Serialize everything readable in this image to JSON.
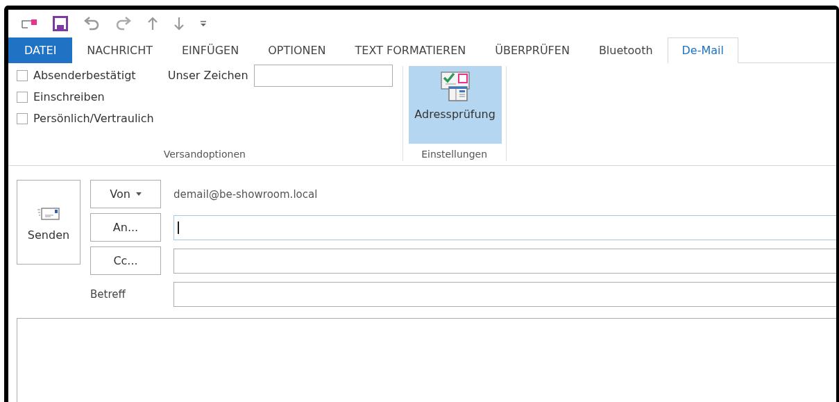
{
  "tabs": [
    {
      "label": "DATEI",
      "kind": "file",
      "selected": false
    },
    {
      "label": "NACHRICHT",
      "kind": "tab",
      "selected": false
    },
    {
      "label": "EINFÜGEN",
      "kind": "tab",
      "selected": false
    },
    {
      "label": "OPTIONEN",
      "kind": "tab",
      "selected": false
    },
    {
      "label": "TEXT FORMATIEREN",
      "kind": "tab",
      "selected": false
    },
    {
      "label": "ÜBERPRÜFEN",
      "kind": "tab",
      "selected": false
    },
    {
      "label": "Bluetooth",
      "kind": "tab",
      "selected": false
    },
    {
      "label": "De-Mail",
      "kind": "tab",
      "selected": true
    }
  ],
  "ribbon": {
    "groups": [
      {
        "label": "Versandoptionen",
        "checkboxes": [
          {
            "label": "Absenderbestätigt",
            "checked": false
          },
          {
            "label": "Einschreiben",
            "checked": false
          },
          {
            "label": "Persönlich/Vertraulich",
            "checked": false
          }
        ],
        "field": {
          "label": "Unser Zeichen"
        }
      },
      {
        "label": "Einstellungen",
        "button": {
          "label": "Adressprüfung",
          "on": true
        }
      }
    ]
  },
  "compose": {
    "send": {
      "label": "Senden"
    },
    "rows": [
      {
        "kind": "from",
        "button": "Von",
        "value": "demail@be-showroom.local"
      },
      {
        "kind": "field",
        "button": "An...",
        "focused": true
      },
      {
        "kind": "field",
        "button": "Cc...",
        "focused": false
      },
      {
        "kind": "label",
        "label": "Betreff",
        "focused": false
      }
    ]
  }
}
